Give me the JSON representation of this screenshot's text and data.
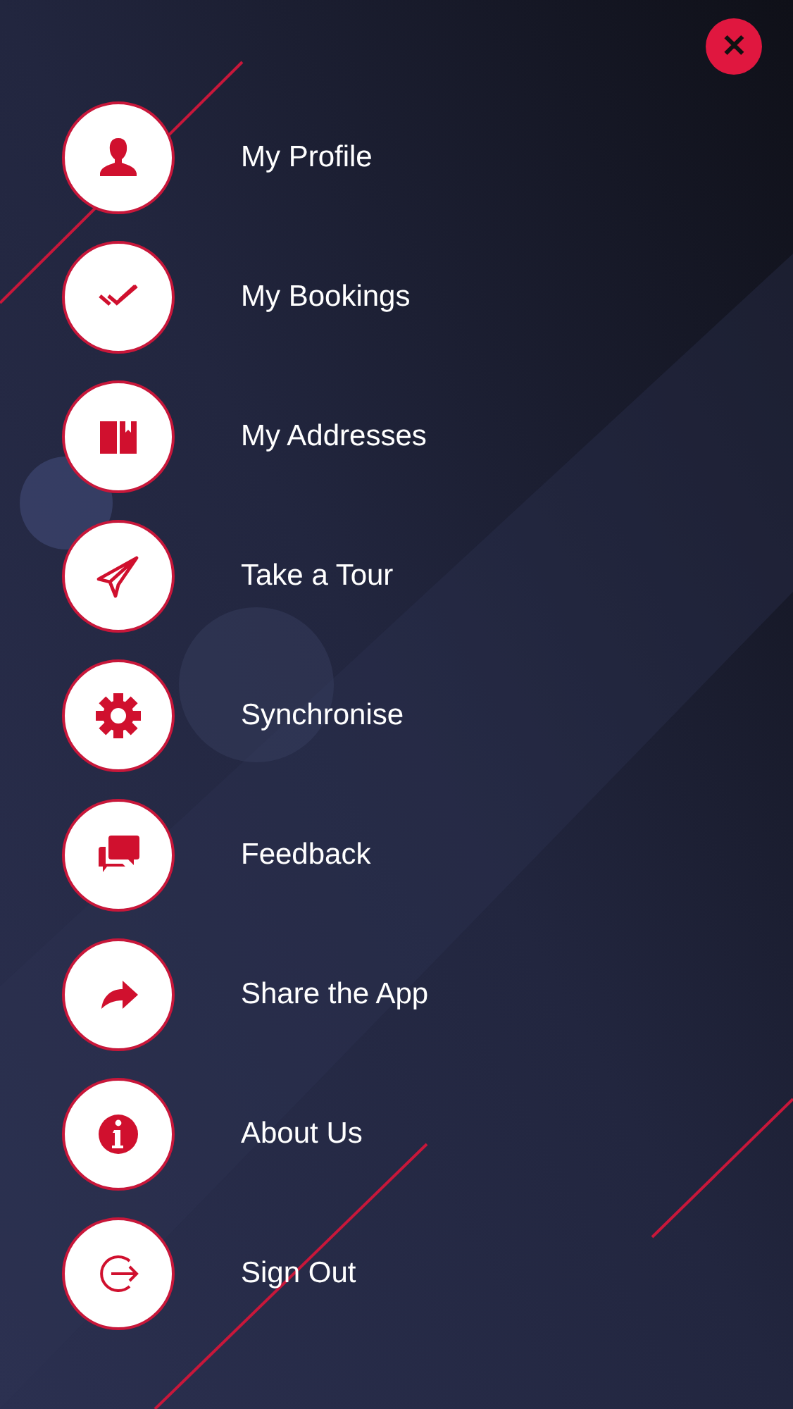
{
  "close_button": {
    "label": "✕"
  },
  "menu": [
    {
      "label": "My Profile",
      "kind": "profile"
    },
    {
      "label": "My Bookings",
      "kind": "bookings"
    },
    {
      "label": "My Addresses",
      "kind": "addresses"
    },
    {
      "label": "Take a Tour",
      "kind": "tour"
    },
    {
      "label": "Synchronise",
      "kind": "sync"
    },
    {
      "label": "Feedback",
      "kind": "feedback"
    },
    {
      "label": "Share the App",
      "kind": "share"
    },
    {
      "label": "About Us",
      "kind": "about"
    },
    {
      "label": "Sign Out",
      "kind": "signout"
    }
  ]
}
